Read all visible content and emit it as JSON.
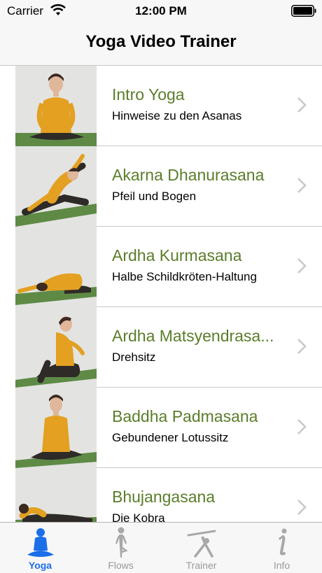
{
  "status_bar": {
    "carrier": "Carrier",
    "time": "12:00 PM",
    "wifi_icon": "wifi-icon",
    "battery_icon": "battery-icon"
  },
  "nav": {
    "title": "Yoga Video Trainer"
  },
  "colors": {
    "title_green": "#5a7d2a",
    "tab_active_blue": "#1a6ee8",
    "tab_inactive_gray": "#9a9a9a"
  },
  "list": {
    "items": [
      {
        "title": "Intro Yoga",
        "subtitle": "Hinweise zu den Asanas",
        "thumbnail": "yoga-seated-pose-photo"
      },
      {
        "title": "Akarna Dhanurasana",
        "subtitle": "Pfeil und Bogen",
        "thumbnail": "yoga-bow-and-arrow-pose-photo"
      },
      {
        "title": "Ardha Kurmasana",
        "subtitle": "Halbe Schildkröten-Haltung",
        "thumbnail": "yoga-half-tortoise-pose-photo"
      },
      {
        "title": "Ardha Matsyendrasa...",
        "subtitle": "Drehsitz",
        "thumbnail": "yoga-seated-twist-photo"
      },
      {
        "title": "Baddha Padmasana",
        "subtitle": "Gebundener Lotussitz",
        "thumbnail": "yoga-bound-lotus-photo"
      },
      {
        "title": "Bhujangasana",
        "subtitle": "Die Kobra",
        "thumbnail": "yoga-cobra-pose-photo"
      }
    ]
  },
  "tab_bar": {
    "tabs": [
      {
        "label": "Yoga",
        "icon": "meditation-icon",
        "active": true
      },
      {
        "label": "Flows",
        "icon": "standing-figure-icon",
        "active": false
      },
      {
        "label": "Trainer",
        "icon": "triangle-pose-icon",
        "active": false
      },
      {
        "label": "Info",
        "icon": "info-icon",
        "active": false
      }
    ]
  }
}
